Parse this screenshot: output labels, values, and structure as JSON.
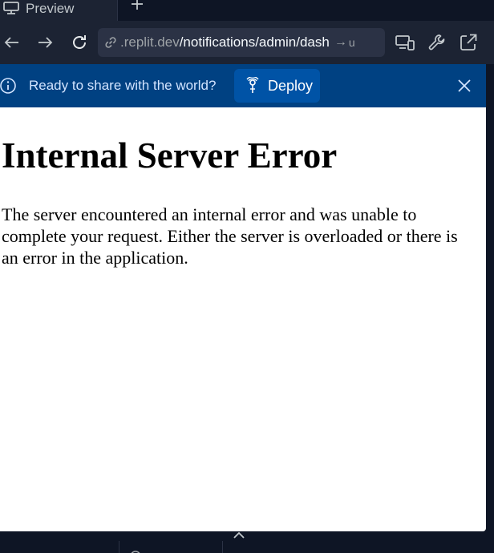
{
  "tabs": {
    "preview_label": "Preview"
  },
  "address_bar": {
    "domain": ".replit.dev",
    "path": "/notifications/admin/dash",
    "arrow": "→",
    "tail": "u"
  },
  "banner": {
    "message": "Ready to share with the world?",
    "deploy_label": "Deploy"
  },
  "page": {
    "heading": "Internal Server Error",
    "body": "The server encountered an internal error and was unable to complete your request. Either the server is overloaded or there is an error in the application."
  },
  "icons": {
    "tab": "monitor-icon",
    "new_tab": "plus-icon",
    "back": "arrow-left-icon",
    "forward": "arrow-right-icon",
    "reload": "reload-icon",
    "link": "link-icon",
    "devices": "devices-icon",
    "devtools": "wrench-icon",
    "open_new": "external-link-icon",
    "info": "info-icon",
    "deploy": "deploy-icon",
    "close": "close-icon",
    "expand": "chevron-up-icon"
  },
  "colors": {
    "app_bg": "#0e1525",
    "toolbar_bg": "#1c2333",
    "address_bg": "#2b3245",
    "banner_bg": "#004182",
    "deploy_bg": "#0053a6",
    "banner_text": "#d2e4ff"
  }
}
